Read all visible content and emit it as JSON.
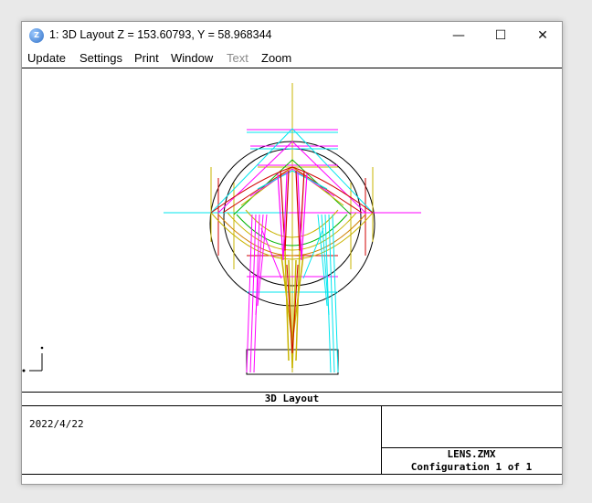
{
  "window": {
    "title": "1: 3D Layout Z = 153.60793, Y = 58.968344",
    "app_icon_glyph": "Z",
    "controls": {
      "minimize": "—",
      "maximize": "☐",
      "close": "✕"
    }
  },
  "menu": {
    "items": [
      {
        "label": "Update",
        "enabled": true
      },
      {
        "label": "Settings",
        "enabled": true
      },
      {
        "label": "Print",
        "enabled": true
      },
      {
        "label": "Window",
        "enabled": true
      },
      {
        "label": "Text",
        "enabled": false
      },
      {
        "label": "Zoom",
        "enabled": true
      }
    ]
  },
  "plot": {
    "name": "3D Layout",
    "date": "2022/4/22",
    "file": "LENS.ZMX",
    "configuration": "Configuration 1 of 1",
    "colors": {
      "black": "#000000",
      "yellow": "#c8b400",
      "cyan": "#00e5ee",
      "magenta": "#ff00ff",
      "red": "#d00000",
      "green": "#00b400",
      "orange": "#d08000"
    }
  }
}
